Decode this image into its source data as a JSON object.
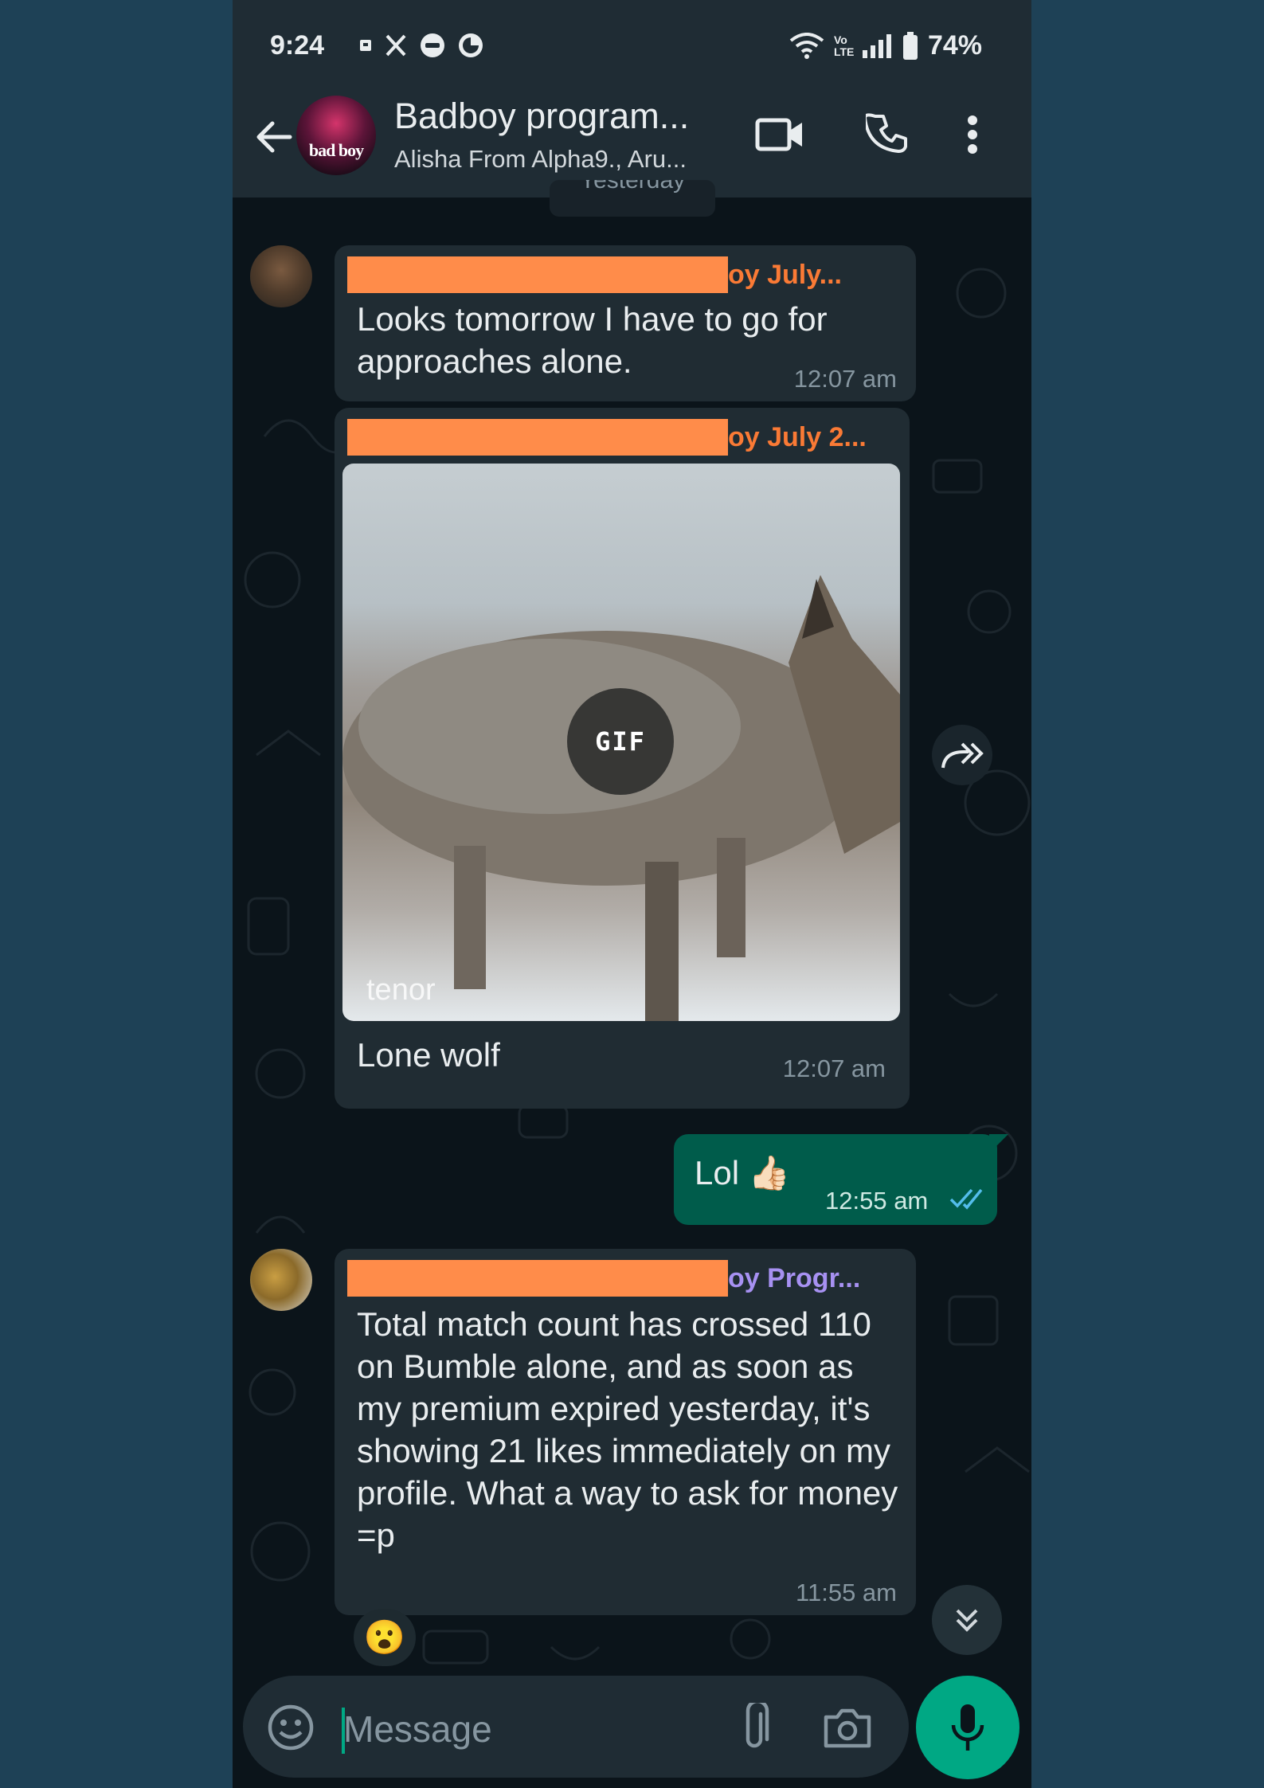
{
  "status_bar": {
    "time": "9:24",
    "battery": "74%",
    "network_label": "Vo LTE"
  },
  "header": {
    "title": "Badboy program...",
    "subtitle": "Alisha From Alpha9., Aru...",
    "avatar_text": "bad boy",
    "icons": [
      "back-arrow-icon",
      "video-call-icon",
      "voice-call-icon",
      "more-options-icon"
    ]
  },
  "date_chip": "Yesterday",
  "messages": [
    {
      "sender": "oy July...",
      "sender_color": "#fa7a35",
      "text": "Looks tomorrow I have to go for approaches alone.",
      "time": "12:07 am"
    },
    {
      "sender": "oy July 2...",
      "sender_color": "#fa7a35",
      "gif_badge": "GIF",
      "gif_source": "tenor",
      "caption": "Lone wolf",
      "time": "12:07 am"
    },
    {
      "outgoing": true,
      "text": "Lol 👍🏻",
      "time": "12:55 am",
      "status": "read"
    },
    {
      "sender": "oy Progr...",
      "sender_color": "#a791f2",
      "text": "Total match count has crossed 110 on Bumble alone, and as soon as my premium expired yesterday, it's showing 21 likes immediately on my profile. What a way to ask for money =p",
      "time": "11:55 am",
      "reaction": "😮"
    }
  ],
  "input": {
    "placeholder": "Message"
  },
  "colors": {
    "background": "#0b141a",
    "bar": "#1f2c34",
    "incoming_bubble": "#202c33",
    "outgoing_bubble": "#005c4b",
    "accent": "#00a884",
    "redaction": "#ff8c4a"
  }
}
